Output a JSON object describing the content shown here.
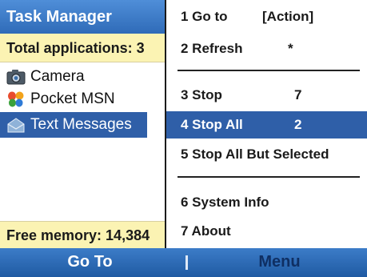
{
  "app": {
    "title": "Task Manager",
    "total_applications": "Total applications: 3",
    "free_memory": "Free memory: 14,384"
  },
  "applications": [
    {
      "label": "Camera",
      "icon": "camera-icon"
    },
    {
      "label": "Pocket MSN",
      "icon": "msn-butterfly-icon"
    },
    {
      "label": "Text Messages",
      "icon": "envelope-icon",
      "selected": true
    }
  ],
  "menu": {
    "items": [
      {
        "label": "1 Go to",
        "shortcut": "[Action]"
      },
      {
        "label": "2 Refresh",
        "shortcut": "*"
      },
      {
        "label": "3 Stop",
        "shortcut": "7"
      },
      {
        "label": "4 Stop All",
        "shortcut": "2",
        "selected": true
      },
      {
        "label": "5 Stop All But Selected",
        "shortcut": ""
      },
      {
        "label": "6 System Info",
        "shortcut": ""
      },
      {
        "label": "7 About",
        "shortcut": ""
      }
    ]
  },
  "softkeys": {
    "left": "Go To",
    "right": "Menu"
  },
  "colors": {
    "title_bar": "#2f6bb8",
    "highlight": "#2f5fa8",
    "info_bar": "#fbf3b3",
    "softkey_bar": "#1f5aa2"
  }
}
